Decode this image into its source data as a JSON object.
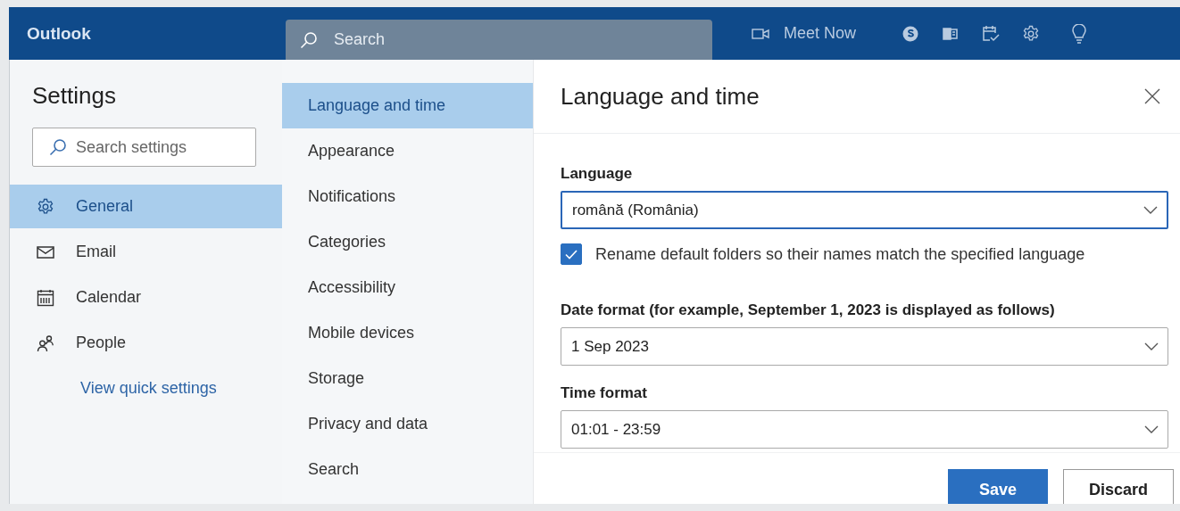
{
  "app": {
    "title": "Outlook"
  },
  "search": {
    "placeholder": "Search"
  },
  "toolbar": {
    "meet_now": "Meet Now"
  },
  "settings_nav": {
    "title": "Settings",
    "search": {
      "placeholder": "Search settings"
    },
    "items": [
      {
        "kind": "gear",
        "label": "General",
        "selected": true
      },
      {
        "kind": "mail",
        "label": "Email",
        "selected": false
      },
      {
        "kind": "calendar",
        "label": "Calendar",
        "selected": false
      },
      {
        "kind": "people",
        "label": "People",
        "selected": false
      }
    ],
    "link": "View quick settings"
  },
  "sections": [
    {
      "label": "Language and time",
      "selected": true
    },
    {
      "label": "Appearance",
      "selected": false
    },
    {
      "label": "Notifications",
      "selected": false
    },
    {
      "label": "Categories",
      "selected": false
    },
    {
      "label": "Accessibility",
      "selected": false
    },
    {
      "label": "Mobile devices",
      "selected": false
    },
    {
      "label": "Storage",
      "selected": false
    },
    {
      "label": "Privacy and data",
      "selected": false
    },
    {
      "label": "Search",
      "selected": false
    }
  ],
  "panel": {
    "title": "Language and time",
    "fields": [
      {
        "kind": "select",
        "label": "Language",
        "value": "română (România)",
        "focused": true
      },
      {
        "kind": "checkbox",
        "label": "Rename default folders so their names match the specified language",
        "checked": true
      },
      {
        "kind": "select",
        "label": "Date format (for example, September 1, 2023 is displayed as follows)",
        "value": "1 Sep 2023",
        "focused": false
      },
      {
        "kind": "select",
        "label": "Time format",
        "value": "01:01 - 23:59",
        "focused": false
      }
    ],
    "buttons": [
      {
        "label": "Save",
        "primary": true
      },
      {
        "label": "Discard",
        "primary": false
      }
    ]
  }
}
